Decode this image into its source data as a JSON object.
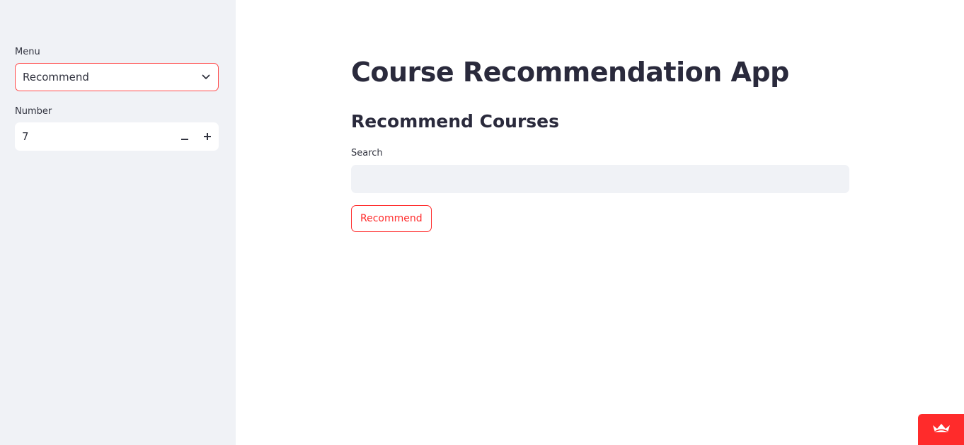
{
  "sidebar": {
    "menu_label": "Menu",
    "menu_selected": "Recommend",
    "number_label": "Number",
    "number_value": "7",
    "decrement_icon": "minus-icon",
    "increment_icon": "plus-icon"
  },
  "main": {
    "title": "Course Recommendation App",
    "subheader": "Recommend Courses",
    "search_label": "Search",
    "search_value": "",
    "recommend_button": "Recommend"
  },
  "badge": {
    "icon": "crown-icon"
  },
  "colors": {
    "accent": "#ff4b4b",
    "sidebar_bg": "#f0f2f6",
    "text": "#31333f"
  }
}
